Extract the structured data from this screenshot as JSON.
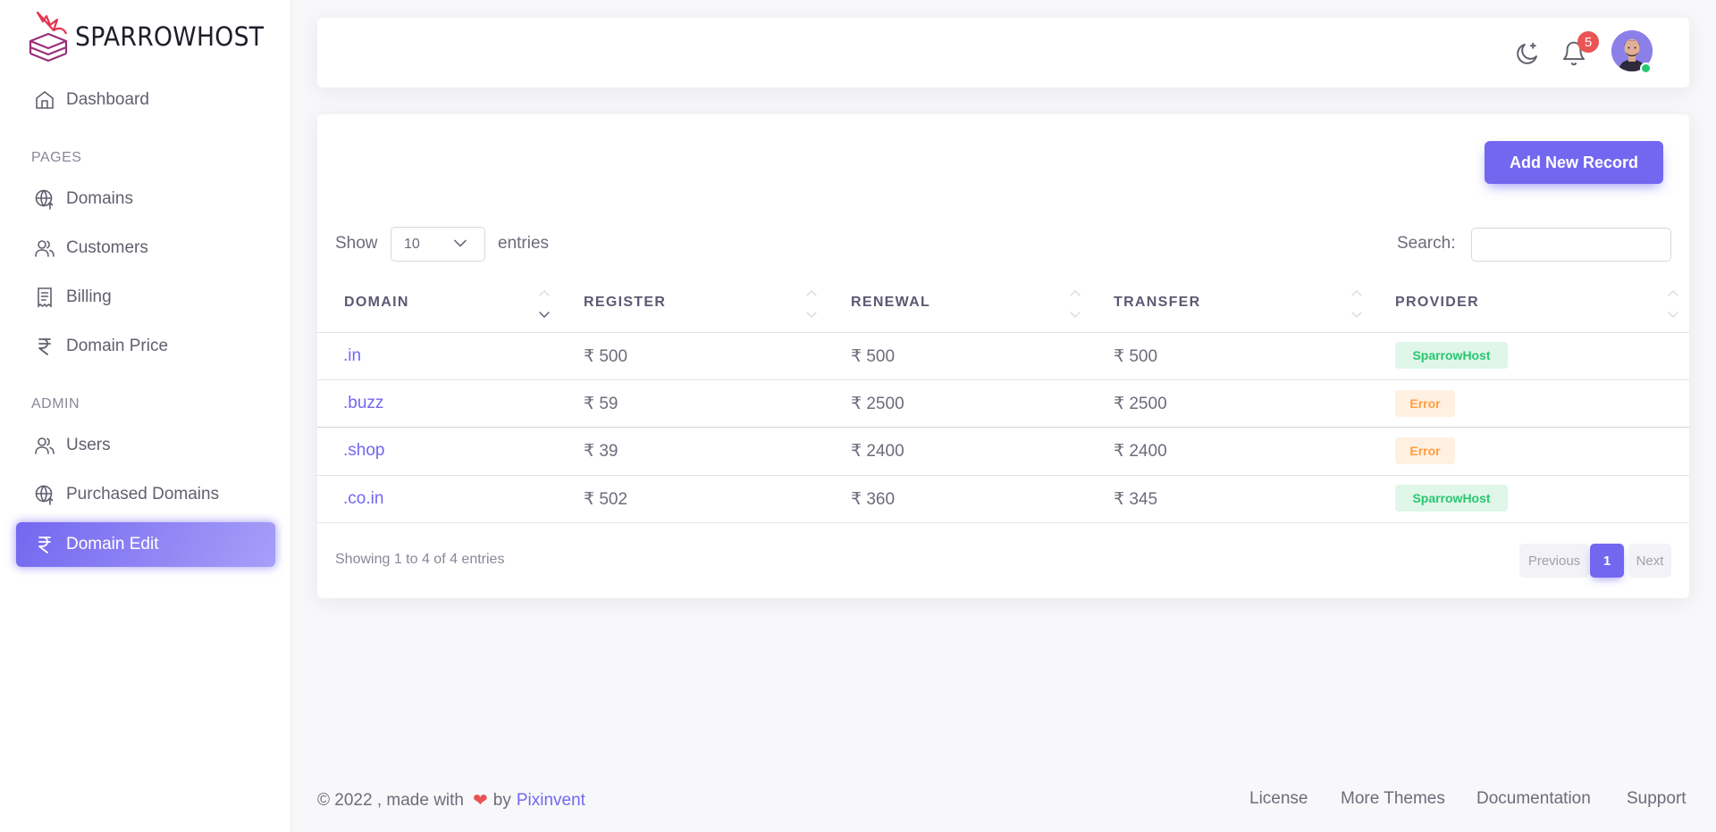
{
  "brand": {
    "name": "SPARROWHOST"
  },
  "sidebar": {
    "dashboard": "Dashboard",
    "pages_header": "PAGES",
    "pages": [
      "Domains",
      "Customers",
      "Billing",
      "Domain Price"
    ],
    "admin_header": "ADMIN",
    "admin": [
      "Users",
      "Purchased Domains",
      "Domain Edit"
    ],
    "active": "Domain Edit"
  },
  "navbar": {
    "notification_count": "5",
    "icons": [
      "moon-icon",
      "bell-icon",
      "avatar"
    ]
  },
  "toolbar": {
    "add_label": "Add New Record",
    "show_label": "Show",
    "entries_label": "entries",
    "page_size": "10",
    "search_label": "Search:",
    "search_value": ""
  },
  "table": {
    "columns": [
      "DOMAIN",
      "REGISTER",
      "RENEWAL",
      "TRANSFER",
      "PROVIDER"
    ],
    "rows": [
      {
        "domain": ".in",
        "register": "₹ 500",
        "renewal": "₹ 500",
        "transfer": "₹ 500",
        "provider": "SparrowHost",
        "status": "success"
      },
      {
        "domain": ".buzz",
        "register": "₹ 59",
        "renewal": "₹ 2500",
        "transfer": "₹ 2500",
        "provider": "Error",
        "status": "warning"
      },
      {
        "domain": ".shop",
        "register": "₹ 39",
        "renewal": "₹ 2400",
        "transfer": "₹ 2400",
        "provider": "Error",
        "status": "warning"
      },
      {
        "domain": ".co.in",
        "register": "₹ 502",
        "renewal": "₹ 360",
        "transfer": "₹ 345",
        "provider": "SparrowHost",
        "status": "success"
      }
    ]
  },
  "pagination": {
    "info": "Showing 1 to 4 of 4 entries",
    "previous": "Previous",
    "current": "1",
    "next": "Next"
  },
  "footer": {
    "copyright": "© 2022 , made with",
    "by": "by",
    "brand": "Pixinvent",
    "links": [
      "License",
      "More Themes",
      "Documentation",
      "Support"
    ]
  },
  "colors": {
    "primary": "#7367f0",
    "success": "#28c76f",
    "warning": "#ff9f43",
    "danger": "#ea5455"
  }
}
